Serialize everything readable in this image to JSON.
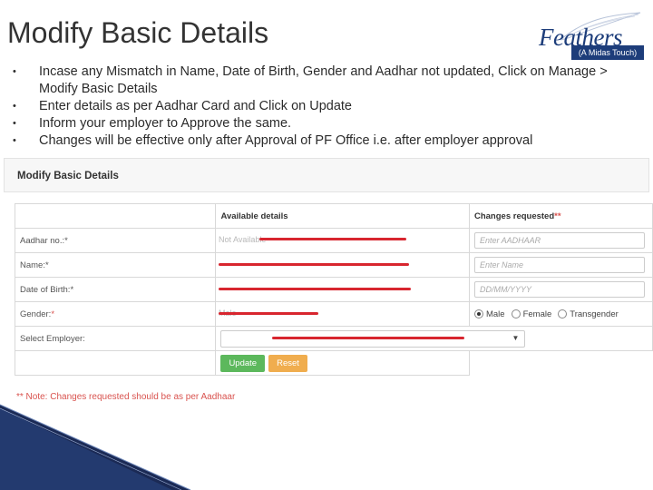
{
  "slide": {
    "title": "Modify Basic Details",
    "bullets": [
      "Incase any Mismatch in Name, Date of Birth, Gender and Aadhar not updated, Click on Manage > Modify Basic Details",
      "Enter details as per Aadhar Card and Click on Update",
      "Inform your employer to Approve the same.",
      "Changes will be effective only after Approval of PF Office i.e. after employer approval"
    ],
    "bullet_glyph": "•"
  },
  "logo": {
    "brand": "Feathers",
    "tagline": "(A Midas Touch)",
    "color": "#1d3d7a"
  },
  "form": {
    "panel_title": "Modify Basic Details",
    "col_available": "Available details",
    "col_changes": "Changes requested",
    "req_mark": "**",
    "rows": {
      "aadhar": {
        "label": "Aadhar no.:*",
        "faded_value": "Not Available",
        "placeholder": "Enter AADHAAR"
      },
      "name": {
        "label": "Name:*",
        "placeholder": "Enter Name"
      },
      "dob": {
        "label": "Date of Birth:*",
        "placeholder": "DD/MM/YYYY"
      },
      "gender": {
        "label": "Gender:*",
        "faded_value": "Male",
        "options": [
          "Male",
          "Female",
          "Transgender"
        ],
        "selected": "Male"
      },
      "employer": {
        "label": "Select Employer:"
      }
    },
    "update_label": "Update",
    "reset_label": "Reset",
    "note": "** Note: Changes requested should be as per Aadhaar",
    "colors": {
      "update": "#5cb85c",
      "reset": "#f0ad4e",
      "redaction": "#d8262f",
      "required": "#d9534f"
    }
  }
}
